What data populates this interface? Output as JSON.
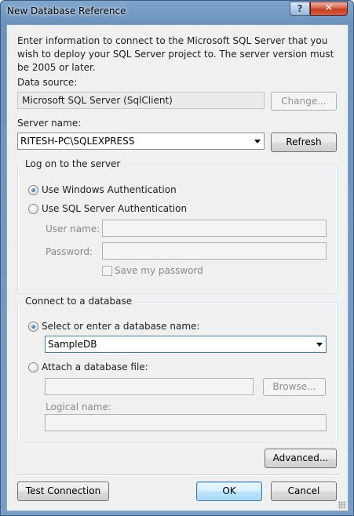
{
  "window": {
    "title": "New Database Reference",
    "help_glyph": "?",
    "close_glyph": "✕"
  },
  "intro": "Enter information to connect to the Microsoft SQL Server that you wish to deploy your SQL Server project to.  The server version must be 2005 or later.",
  "data_source": {
    "label": "Data source:",
    "value": "Microsoft SQL Server (SqlClient)",
    "change_button": "Change..."
  },
  "server": {
    "label": "Server name:",
    "value": "RITESH-PC\\SQLEXPRESS",
    "refresh_button": "Refresh"
  },
  "logon": {
    "group_title": "Log on to the server",
    "windows_auth": "Use Windows Authentication",
    "sql_auth": "Use SQL Server Authentication",
    "selected": "windows",
    "user_name_label": "User name:",
    "password_label": "Password:",
    "save_password": "Save my password",
    "save_password_checked": false
  },
  "database": {
    "group_title": "Connect to a database",
    "select_label": "Select or enter a database name:",
    "database_name": "SampleDB",
    "attach_label": "Attach a database file:",
    "browse_button": "Browse...",
    "logical_name_label": "Logical name:",
    "selected": "select"
  },
  "buttons": {
    "advanced": "Advanced...",
    "test_connection": "Test Connection",
    "ok": "OK",
    "cancel": "Cancel"
  }
}
